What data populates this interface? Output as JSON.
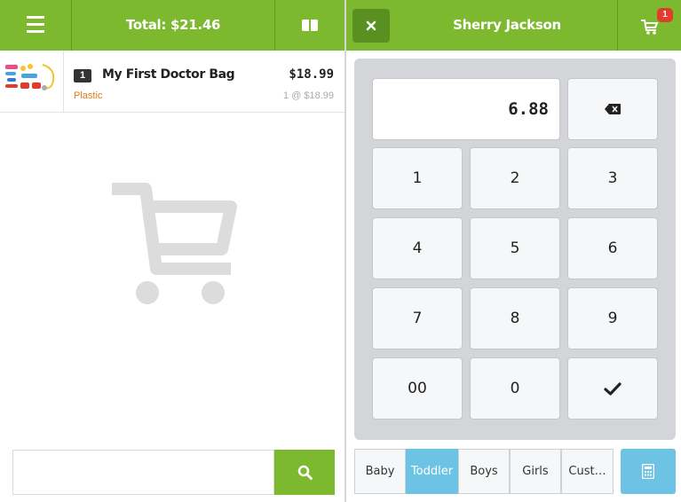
{
  "header": {
    "total_label": "Total: $21.46",
    "customer_name": "Sherry Jackson",
    "cart_badge": "1"
  },
  "cart": {
    "items": [
      {
        "qty": "1",
        "name": "My First Doctor Bag",
        "variant": "Plastic",
        "price": "$18.99",
        "unit_price": "1 @ $18.99"
      }
    ]
  },
  "search": {
    "value": "",
    "placeholder": ""
  },
  "keypad": {
    "display": "6.88",
    "keys": [
      "1",
      "2",
      "3",
      "4",
      "5",
      "6",
      "7",
      "8",
      "9",
      "00",
      "0"
    ]
  },
  "tabs": [
    {
      "label": "Baby",
      "active": false
    },
    {
      "label": "Toddler",
      "active": true
    },
    {
      "label": "Boys",
      "active": false
    },
    {
      "label": "Girls",
      "active": false
    },
    {
      "label": "Cust…",
      "active": false
    }
  ],
  "colors": {
    "brand_green": "#7cb92f",
    "accent_blue": "#6cc3e3",
    "badge_red": "#e23b2c",
    "variant_orange": "#e07b16"
  },
  "icons": [
    "menu-icon",
    "screen-icon",
    "close-icon",
    "cart-icon",
    "cart-placeholder-icon",
    "search-icon",
    "backspace-icon",
    "check-icon",
    "calculator-icon"
  ]
}
